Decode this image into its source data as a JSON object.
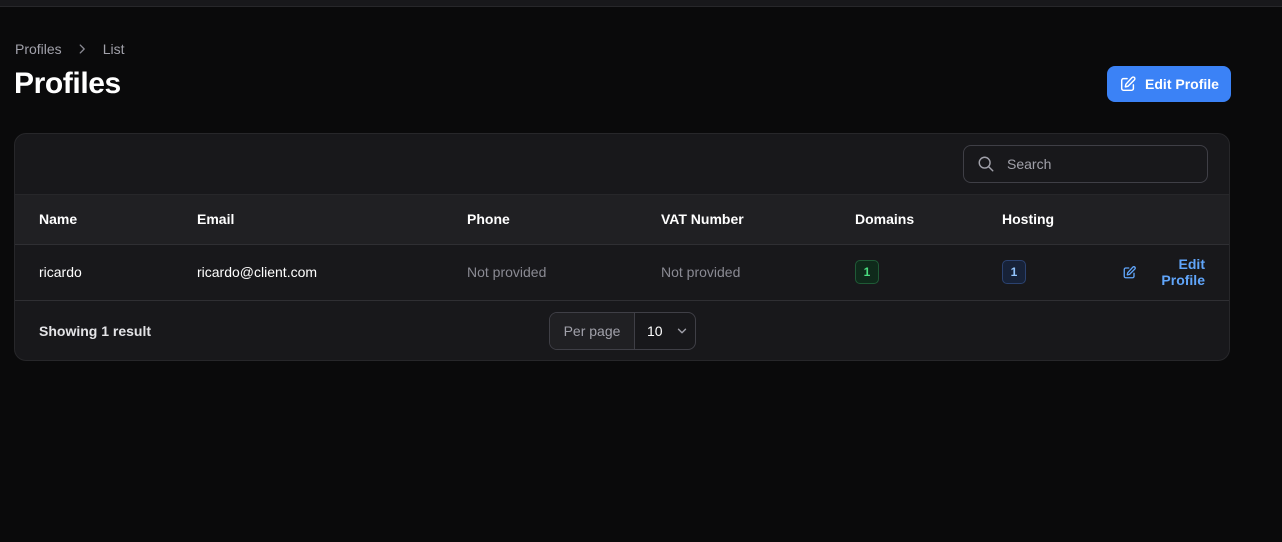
{
  "breadcrumb": {
    "items": [
      "Profiles",
      "List"
    ]
  },
  "page": {
    "title": "Profiles",
    "primary_action_label": "Edit Profile",
    "primary_action_icon": "pencil-square-icon"
  },
  "search": {
    "placeholder": "Search",
    "value": ""
  },
  "table": {
    "columns": [
      "Name",
      "Email",
      "Phone",
      "VAT Number",
      "Domains",
      "Hosting"
    ],
    "rows": [
      {
        "name": "ricardo",
        "email": "ricardo@client.com",
        "phone": "Not provided",
        "vat_number": "Not provided",
        "domains": "1",
        "hosting": "1",
        "action_label": "Edit Profile"
      }
    ]
  },
  "footer": {
    "result_text": "Showing 1 result",
    "per_page_label": "Per page",
    "per_page_value": "10"
  },
  "colors": {
    "accent": "#3b82f6",
    "background": "#0a0a0b",
    "card": "#18181b",
    "badge_green": "#4ade80",
    "badge_blue": "#93c5fd"
  }
}
